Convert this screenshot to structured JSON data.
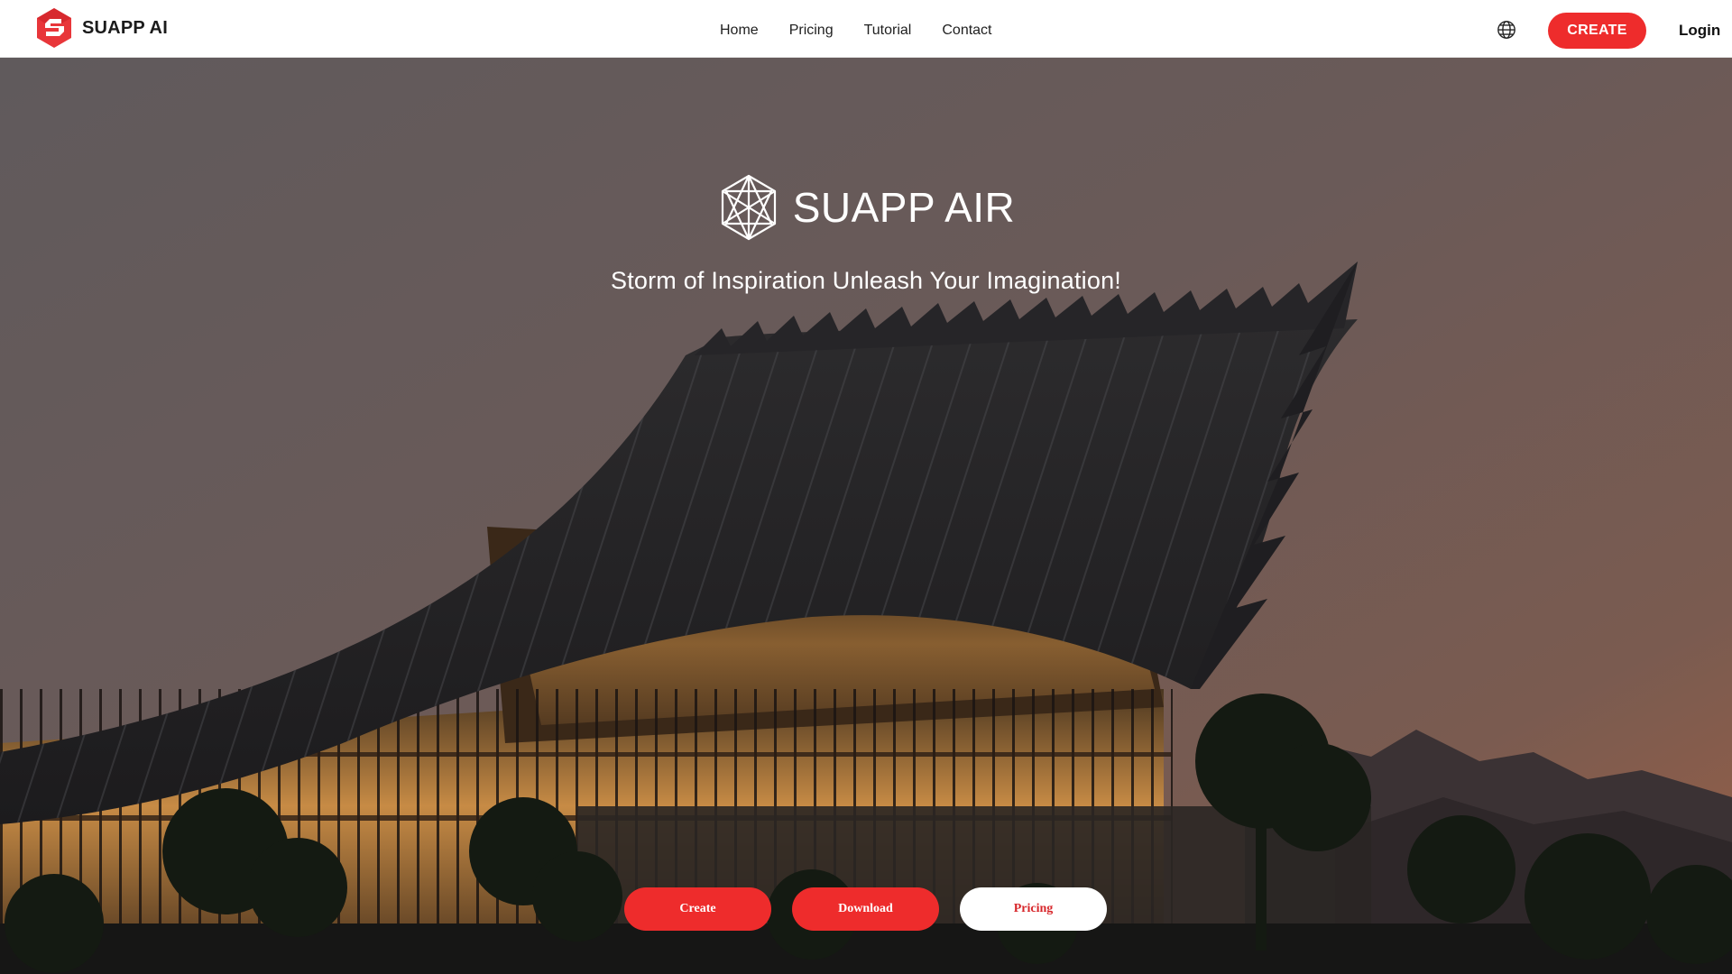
{
  "brand": {
    "name": "SUAPP AI",
    "accent": "#ee2c2c"
  },
  "nav": {
    "items": [
      {
        "label": "Home"
      },
      {
        "label": "Pricing"
      },
      {
        "label": "Tutorial"
      },
      {
        "label": "Contact"
      }
    ]
  },
  "header": {
    "language_icon": "globe-icon",
    "create_label": "CREATE",
    "login_label": "Login"
  },
  "hero": {
    "icon": "geometric-star-icon",
    "title": "SUAPP AIR",
    "subtitle": "Storm of Inspiration Unleash Your Imagination!",
    "buttons": {
      "create": "Create",
      "download": "Download",
      "pricing": "Pricing"
    }
  }
}
